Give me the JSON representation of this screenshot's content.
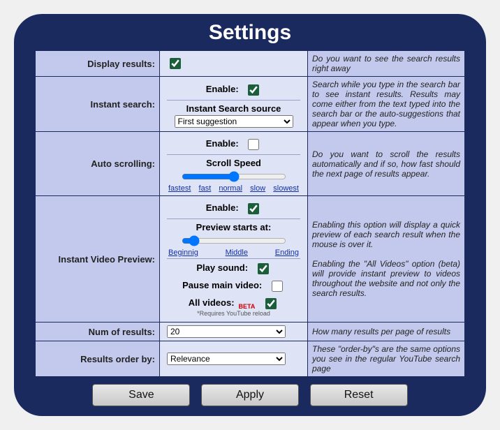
{
  "title": "Settings",
  "rows": {
    "display": {
      "label": "Display results:",
      "checked": true,
      "desc": "Do you want to see the search results right away"
    },
    "instant": {
      "label": "Instant search:",
      "enable_label": "Enable:",
      "enable_checked": true,
      "source_label": "Instant Search source",
      "source_value": "First suggestion",
      "desc": "Search while you type in the search bar to see instant results. Results may come either from the text typed into the search bar or the auto-suggestions that appear when you type."
    },
    "autoscroll": {
      "label": "Auto scrolling:",
      "enable_label": "Enable:",
      "enable_checked": false,
      "speed_label": "Scroll Speed",
      "links": {
        "fastest": "fastest",
        "fast": "fast",
        "normal": "normal",
        "slow": "slow",
        "slowest": "slowest"
      },
      "desc": "Do you want to scroll the results automatically and if so, how fast should the next page of results appear."
    },
    "preview": {
      "label": "Instant Video Preview:",
      "enable_label": "Enable:",
      "enable_checked": true,
      "starts_label": "Preview starts at:",
      "pos_links": {
        "begin": "Beginnig",
        "middle": "Middle",
        "end": "Ending"
      },
      "playsound_label": "Play sound:",
      "playsound_checked": true,
      "pause_label": "Pause main video:",
      "pause_checked": false,
      "allvideos_label": "All videos:",
      "allvideos_checked": true,
      "beta": "BETA",
      "fineprint": "*Requires YouTube reload",
      "desc1": "Enabling this option will display a quick preview of each search result when the mouse is over it.",
      "desc2": "Enabling the \"All Videos\" option (beta) will provide instant preview to videos throughout the website and not only the search results."
    },
    "num": {
      "label": "Num of results:",
      "value": "20",
      "desc": "How many results per page of results"
    },
    "order": {
      "label": "Results order by:",
      "value": "Relevance",
      "desc": "These \"order-by\"s are the same options you see in the regular YouTube search page"
    }
  },
  "buttons": {
    "save": "Save",
    "apply": "Apply",
    "reset": "Reset"
  }
}
